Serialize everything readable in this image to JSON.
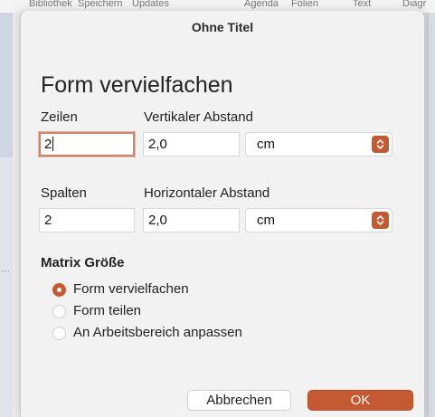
{
  "background": {
    "toolbar_items": [
      "Bibliothek",
      "Speichern",
      "Updates",
      "Agenda",
      "Folien",
      "Text",
      "Diagr"
    ],
    "overflow_dots": "···"
  },
  "dialog": {
    "window_title": "Ohne Titel",
    "heading": "Form vervielfachen",
    "rows_label": "Zeilen",
    "rows_value": "2",
    "vertical_spacing_label": "Vertikaler Abstand",
    "vertical_spacing_value": "2,0",
    "vertical_unit": "cm",
    "columns_label": "Spalten",
    "columns_value": "2",
    "horizontal_spacing_label": "Horizontaler Abstand",
    "horizontal_spacing_value": "2,0",
    "horizontal_unit": "cm",
    "matrix_section_label": "Matrix Größe",
    "options": [
      {
        "label": "Form vervielfachen",
        "selected": true
      },
      {
        "label": "Form teilen",
        "selected": false
      },
      {
        "label": "An Arbeitsbereich anpassen",
        "selected": false
      }
    ],
    "cancel_label": "Abbrechen",
    "ok_label": "OK"
  },
  "colors": {
    "accent": "#c55a32",
    "focus_ring": "#cf8668"
  },
  "icons": {
    "select_stepper": "chevron-up-down-icon"
  }
}
